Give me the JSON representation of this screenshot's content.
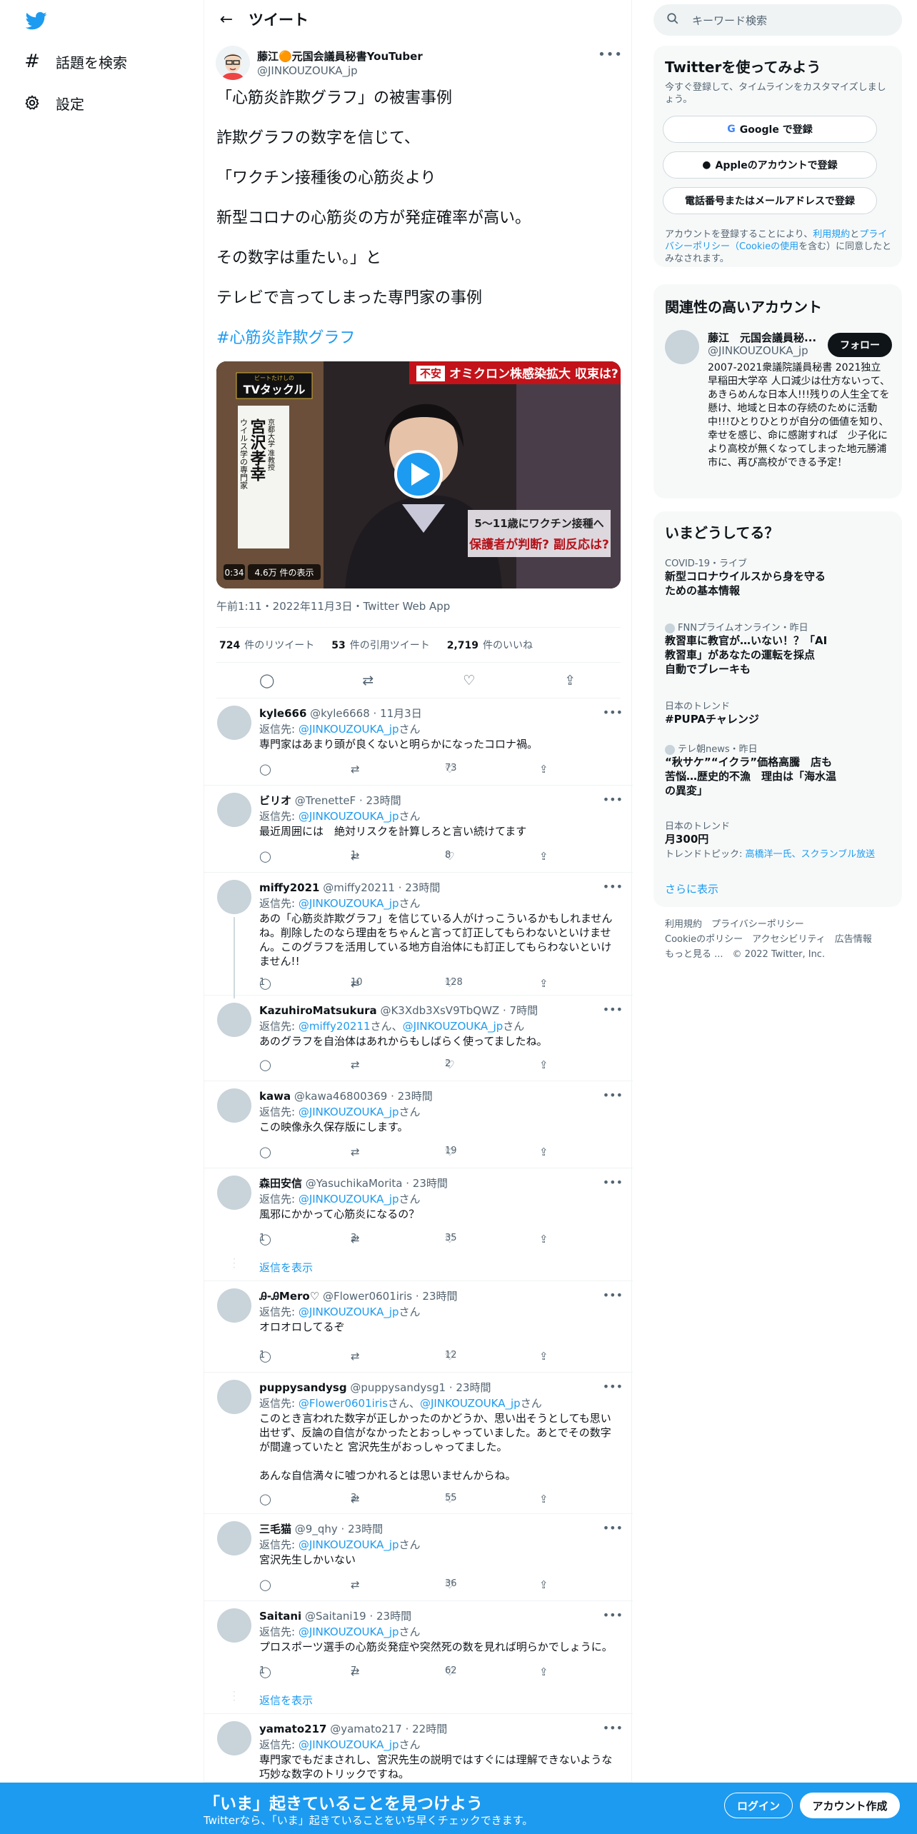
{
  "nav": {
    "explore": "話題を検索",
    "settings": "設定"
  },
  "header": {
    "title": "ツイート"
  },
  "tweet": {
    "name": "藤江🟠元国会議員秘書YouTuber",
    "handle": "@JINKOUZOUKA_jp",
    "lines": [
      "「心筋炎詐欺グラフ」の被害事例",
      "詐欺グラフの数字を信じて、",
      "「ワクチン接種後の心筋炎より",
      "新型コロナの心筋炎の方が発症確率が高い。",
      "その数字は重たい。」と",
      "テレビで言ってしまった専門家の事例"
    ],
    "hashtag": "#心筋炎詐欺グラフ",
    "video": {
      "duration": "0:34",
      "views": "4.6万 件の表示",
      "caption_top": "オミクロン株感染拡大 収束は?",
      "caption_flag": "不安",
      "show_name": "TVタックル",
      "show_kana": "ビートたけしの",
      "guest_name": "宮沢孝幸",
      "guest_affil": "京都大学 准教授",
      "guest_field": "ウイルス学の専門家",
      "caption_bottom1": "5〜11歳にワクチン接種へ",
      "caption_bottom2": "保護者が判断? 副反応は?"
    },
    "timestamp": "午前1:11・2022年11月3日・Twitter Web App",
    "retweets": "724",
    "retweets_label": "件のリツイート",
    "quotes": "53",
    "quotes_label": "件の引用ツイート",
    "likes": "2,719",
    "likes_label": "件のいいね"
  },
  "replies": [
    {
      "name": "kyle666",
      "handle": "@kyle6668",
      "time": "11月3日",
      "to": "@JINKOUZOUKA_jp",
      "text": "専門家はあまり頭が良くないと明らかになったコロナ禍。",
      "replies": "",
      "retweets": "",
      "likes": "73"
    },
    {
      "name": "ビリオ",
      "handle": "@TrenetteF",
      "time": "23時間",
      "to": "@JINKOUZOUKA_jp",
      "text": "最近周囲には　絶対リスクを計算しろと言い続けてます",
      "replies": "",
      "retweets": "1",
      "likes": "8"
    },
    {
      "name": "miffy2021",
      "handle": "@miffy20211",
      "time": "23時間",
      "to": "@JINKOUZOUKA_jp",
      "text": "あの「心筋炎詐欺グラフ」を信じている人がけっこういるかもしれませんね。削除したのなら理由をちゃんと言って訂正してもらわないといけません。このグラフを活用している地方自治体にも訂正してもらわないといけません!!",
      "replies": "1",
      "retweets": "10",
      "likes": "128"
    },
    {
      "name": "KazuhiroMatsukura",
      "handle": "@K3Xdb3XsV9TbQWZ",
      "time": "7時間",
      "to": "@miffy20211",
      "to2": "@JINKOUZOUKA_jp",
      "text": "あのグラフを自治体はあれからもしばらく使ってましたね。",
      "replies": "",
      "retweets": "",
      "likes": "2"
    },
    {
      "name": "kawa",
      "handle": "@kawa46800369",
      "time": "23時間",
      "to": "@JINKOUZOUKA_jp",
      "text": "この映像永久保存版にします。",
      "replies": "",
      "retweets": "",
      "likes": "19"
    },
    {
      "name": "森田安信",
      "handle": "@YasuchikaMorita",
      "time": "23時間",
      "to": "@JINKOUZOUKA_jp",
      "text": "風邪にかかって心筋炎になるの？",
      "replies": "1",
      "retweets": "3",
      "likes": "35",
      "show": "返信を表示"
    },
    {
      "name": "Ꭿ-ᎯMero♡",
      "handle": "@Flower0601iris",
      "time": "23時間",
      "to": "@JINKOUZOUKA_jp",
      "text": "オロオロしてるぞ",
      "replies": "1",
      "retweets": "",
      "likes": "12"
    },
    {
      "name": "puppysandysg",
      "handle": "@puppysandysg1",
      "time": "23時間",
      "to": "@Flower0601iris",
      "to2": "@JINKOUZOUKA_jp",
      "text": "このとき言われた数字が正しかったのかどうか、思い出そうとしても思い出せず、反論の自信がなかったとおっしゃっていました。あとでその数字が間違っていたと 宮沢先生がおっしゃってました。\n\nあんな自信満々に嘘つかれるとは思いませんからね。",
      "replies": "",
      "retweets": "3",
      "likes": "55"
    },
    {
      "name": "三毛猫",
      "handle": "@9_qhy",
      "time": "23時間",
      "to": "@JINKOUZOUKA_jp",
      "text": "宮沢先生しかいない",
      "replies": "",
      "retweets": "",
      "likes": "36"
    },
    {
      "name": "Saitani",
      "handle": "@Saitani19",
      "time": "23時間",
      "to": "@JINKOUZOUKA_jp",
      "text": "プロスポーツ選手の心筋炎発症や突然死の数を見れば明らかでしょうに。",
      "replies": "1",
      "retweets": "7",
      "likes": "62",
      "show": "返信を表示"
    },
    {
      "name": "yamato217",
      "handle": "@yamato217",
      "time": "22時間",
      "to": "@JINKOUZOUKA_jp",
      "text": "専門家でもだまされし、宮沢先生の説明ではすぐには理解できないような巧妙な数字のトリックですね。",
      "replies": "",
      "retweets": "",
      "likes": ""
    }
  ],
  "reply_to_prefix": "返信先: ",
  "reply_to_suffix": "さん",
  "right": {
    "search_placeholder": "キーワード検索",
    "signup": {
      "title": "Twitterを使ってみよう",
      "sub": "今すぐ登録して、タイムラインをカスタマイズしましょう。",
      "google": "Google で登録",
      "apple": "Appleのアカウントで登録",
      "phone": "電話番号またはメールアドレスで登録",
      "terms_pre": "アカウントを登録することにより、",
      "terms_link": "利用規約",
      "terms_mid": "と",
      "privacy_link": "プライバシーポリシー",
      "cookie_link": "（Cookieの使用",
      "terms_post": "を含む）に同意したとみなされます。"
    },
    "related": {
      "title": "関連性の高いアカウント",
      "name": "藤江　元国会議員秘...",
      "handle": "@JINKOUZOUKA_jp",
      "follow": "フォロー",
      "bio": "2007-2021衆議院議員秘書 2021独立　早稲田大学卒 人口減少は仕方ないって、あきらめんな日本人!!!残りの人生全てを懸け、地域と日本の存続のために活動中!!!ひとりひとりが自分の価値を知り、幸せを感じ、命に感謝すれば　少子化により高校が無くなってしまった地元勝浦市に、再び高校ができる予定！"
    },
    "trends": {
      "title": "いまどうしてる？",
      "items": [
        {
          "meta": "COVID-19・ライブ",
          "title": "新型コロナウイルスから身を守るための基本情報"
        },
        {
          "meta": "FNNプライムオンライン・昨日",
          "title": "教習車に教官が…いない！？「AI教習車」があなたの運転を採点 自動でブレーキも"
        },
        {
          "meta": "日本のトレンド",
          "title": "#PUPAチャレンジ"
        },
        {
          "meta": "テレ朝news・昨日",
          "title": "“秋サケ”“イクラ”価格高騰　店も苦悩…歴史的不漁　理由は「海水温の異変」"
        },
        {
          "meta": "日本のトレンド",
          "title": "月300円",
          "sub_pre": "トレンドトピック: ",
          "sub_link": "高橋洋一氏、スクランブル放送"
        }
      ],
      "more": "さらに表示"
    },
    "footer": {
      "l1": "利用規約",
      "l2": "プライバシーポリシー",
      "l3": "Cookieのポリシー",
      "l4": "アクセシビリティ",
      "l5": "広告情報",
      "l6": "もっと見る ...",
      "copy": "© 2022 Twitter, Inc."
    }
  },
  "banner": {
    "title": "「いま」起きていることを見つけよう",
    "sub": "Twitterなら、「いま」起きていることをいち早くチェックできます。",
    "login": "ログイン",
    "signup": "アカウント作成"
  },
  "colors": {
    "accent": "#1d9bf0",
    "text": "#0f1419",
    "muted": "#536471",
    "border": "#eff3f4"
  }
}
